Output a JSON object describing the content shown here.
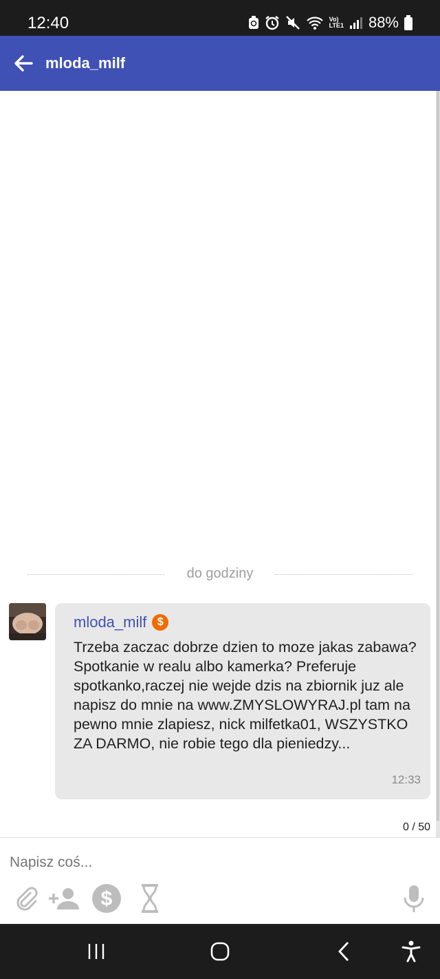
{
  "status_bar": {
    "time": "12:40",
    "battery": "88%",
    "icons": [
      "android-icon",
      "alarm-icon",
      "mute-icon",
      "wifi-icon",
      "volte-icon",
      "signal-icon",
      "battery-icon"
    ],
    "volte_label": "Vo)\nLTE1"
  },
  "app_bar": {
    "title": "mloda_milf",
    "back_icon": "arrow-left-icon",
    "background": "#3f51b5"
  },
  "chat": {
    "date_divider": "do godziny",
    "messages": [
      {
        "sender": "mloda_milf",
        "badge": "$",
        "badge_color": "#ef6c00",
        "text": "Trzeba zaczac dobrze dzien to moze jakas zabawa?Spotkanie w realu albo kamerka? Preferuje spotkanko,raczej nie wejde dzis na zbiornik juz ale napisz do mnie na www.ZMYSLOWYRAJ.pl tam na pewno mnie zlapiesz, nick milfetka01, WSZYSTKO ZA DARMO, nie robie tego dla pieniedzy...",
        "time": "12:33"
      }
    ]
  },
  "composer": {
    "char_counter": "0 / 50",
    "placeholder": "Napisz coś...",
    "value": "",
    "tools": [
      "paperclip-icon",
      "add-person-icon",
      "dollar-icon",
      "hourglass-icon",
      "microphone-icon"
    ]
  },
  "nav_bar": {
    "buttons": [
      "recent-apps-icon",
      "home-icon",
      "back-icon",
      "accessibility-icon"
    ]
  }
}
